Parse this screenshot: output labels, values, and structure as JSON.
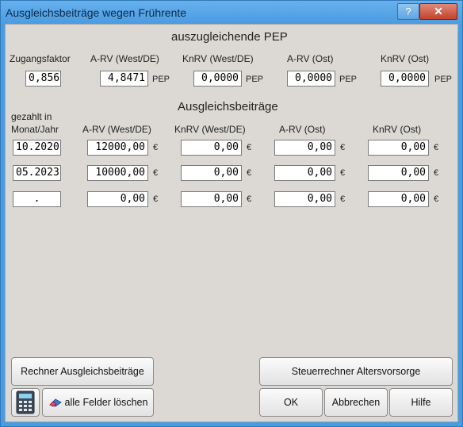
{
  "window": {
    "title": "Ausgleichsbeiträge wegen Frührente",
    "help_label": "?",
    "close_label": "✕"
  },
  "pep": {
    "heading": "auszugleichende PEP",
    "columns": {
      "zugangsfaktor": "Zugangsfaktor",
      "arv_west": "A-RV (West/DE)",
      "knrv_west": "KnRV (West/DE)",
      "arv_ost": "A-RV (Ost)",
      "knrv_ost": "KnRV (Ost)"
    },
    "unit": "PEP",
    "values": {
      "zugangsfaktor": "0,856",
      "arv_west": "4,8471",
      "knrv_west": "0,0000",
      "arv_ost": "0,0000",
      "knrv_ost": "0,0000"
    }
  },
  "beitraege": {
    "heading": "Ausgleichsbeiträge",
    "columns": {
      "date_line1": "gezahlt in",
      "date_line2": "Monat/Jahr",
      "arv_west": "A-RV (West/DE)",
      "knrv_west": "KnRV (West/DE)",
      "arv_ost": "A-RV (Ost)",
      "knrv_ost": "KnRV (Ost)"
    },
    "currency": "€",
    "rows": [
      {
        "date": "10.2020",
        "arv_west": "12000,00",
        "knrv_west": "0,00",
        "arv_ost": "0,00",
        "knrv_ost": "0,00"
      },
      {
        "date": "05.2023",
        "arv_west": "10000,00",
        "knrv_west": "0,00",
        "arv_ost": "0,00",
        "knrv_ost": "0,00"
      },
      {
        "date": ".",
        "arv_west": "0,00",
        "knrv_west": "0,00",
        "arv_ost": "0,00",
        "knrv_ost": "0,00"
      }
    ]
  },
  "buttons": {
    "rechner": "Rechner Ausgleichsbeiträge",
    "steuerrechner": "Steuerrechner Altersvorsorge",
    "clear": "alle Felder löschen",
    "ok": "OK",
    "cancel": "Abbrechen",
    "help": "Hilfe"
  },
  "icons": {
    "calculator": "calculator-icon",
    "eraser": "eraser-icon"
  }
}
